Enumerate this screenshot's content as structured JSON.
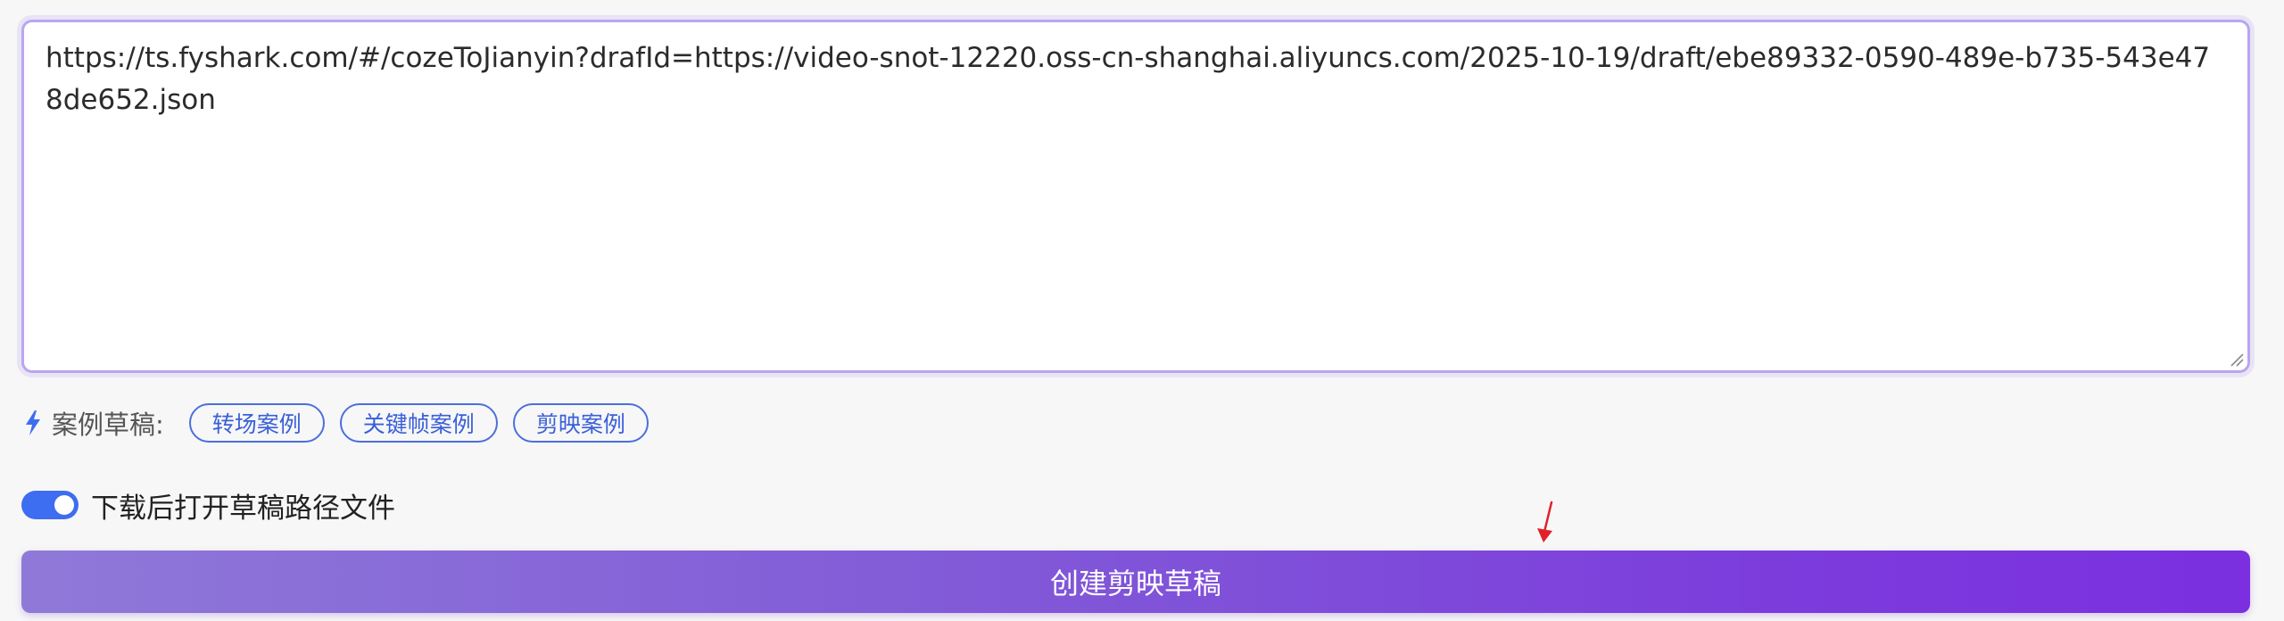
{
  "input": {
    "value": "https://ts.fyshark.com/#/cozeToJianyin?drafId=https://video-snot-12220.oss-cn-shanghai.aliyuncs.com/2025-10-19/draft/ebe89332-0590-489e-b735-543e478de652.json"
  },
  "examples": {
    "icon": "lightning-bolt-icon",
    "label": "案例草稿:",
    "chips": [
      {
        "label": "转场案例"
      },
      {
        "label": "关键帧案例"
      },
      {
        "label": "剪映案例"
      }
    ]
  },
  "toggle": {
    "label": "下载后打开草稿路径文件",
    "checked": true
  },
  "cursor": {
    "icon": "red-arrow-cursor-icon"
  },
  "create_button": {
    "label": "创建剪映草稿"
  },
  "colors": {
    "accent": "#3d6df0",
    "chip_border": "#4c6fdc",
    "input_border": "#b9a6ef",
    "button_gradient_start": "#8f79d8",
    "button_gradient_end": "#7b2fe0",
    "cursor_red": "#e0202a"
  }
}
